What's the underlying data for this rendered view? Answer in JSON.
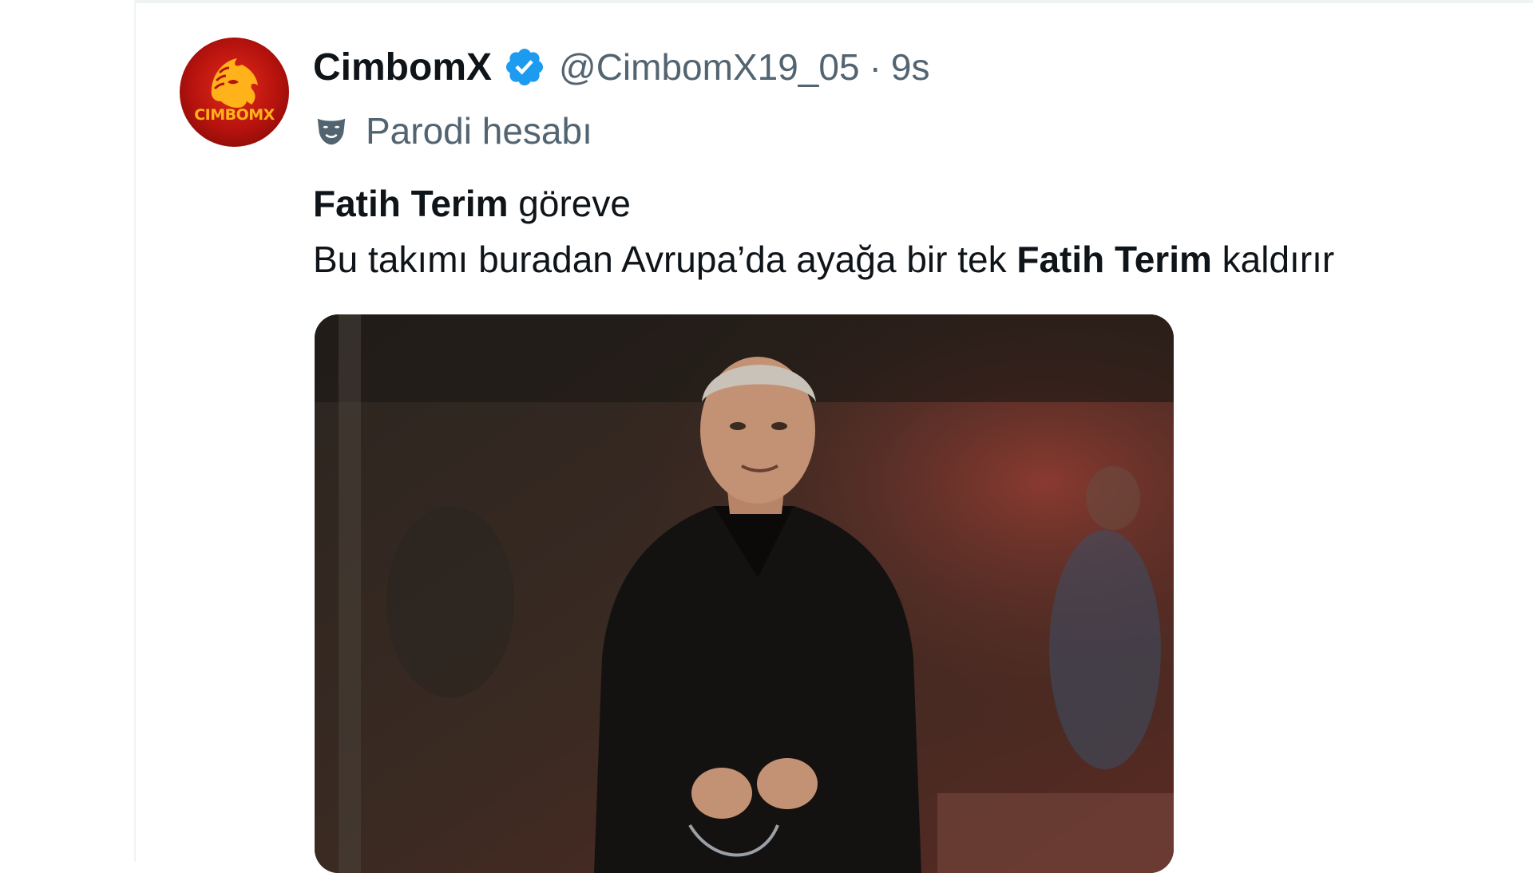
{
  "tweet": {
    "display_name": "CimbomX",
    "handle": "@CimbomX19_05",
    "separator": "·",
    "time": "9s",
    "parody_label": "Parodi hesabı",
    "avatar_text": "CIMBOMX",
    "line1_bold": "Fatih Terim",
    "line1_rest": " göreve",
    "line2_start": "Bu takımı buradan Avrupa’da ayağa bir tek ",
    "line2_bold": "Fatih Terim",
    "line2_end": " kaldırır"
  },
  "icons": {
    "verified": "verified-badge-icon",
    "parody": "parody-mask-icon"
  },
  "colors": {
    "verified_blue": "#1d9bf0",
    "secondary_text": "#536471",
    "avatar_red": "#c8160f",
    "avatar_gold": "#ffb21a"
  }
}
